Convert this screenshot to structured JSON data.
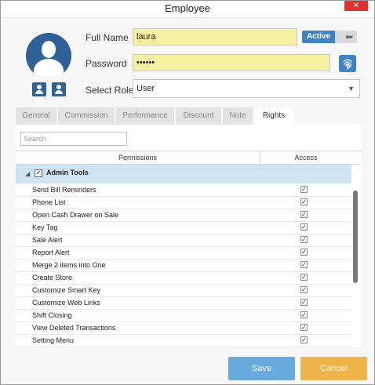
{
  "window": {
    "title": "Employee",
    "close_glyph": "✕"
  },
  "form": {
    "full_name_label": "Full Name",
    "full_name_value": "laura",
    "password_label": "Password",
    "password_value": "••••••",
    "select_role_label": "Select Role",
    "select_role_value": "User",
    "active_label": "Active"
  },
  "icons": {
    "avatar": "user-avatar-icon",
    "user_button_1": "user-icon",
    "user_button_2": "user-lock-icon",
    "fingerprint": "fingerprint-icon",
    "toggle_arrow": "arrow-left-icon",
    "dropdown": "chevron-down-icon"
  },
  "tabs": [
    {
      "label": "General",
      "active": false
    },
    {
      "label": "Commission",
      "active": false
    },
    {
      "label": "Performance",
      "active": false
    },
    {
      "label": "Discount",
      "active": false
    },
    {
      "label": "Note",
      "active": false
    },
    {
      "label": "Rights",
      "active": true
    }
  ],
  "rights": {
    "search_placeholder": "Search",
    "columns": {
      "permissions": "Permissions",
      "access": "Access"
    },
    "group": {
      "label": "Admin Tools",
      "checked": true
    },
    "items": [
      {
        "label": "Send Bill Reminders",
        "access": true
      },
      {
        "label": "Phone List",
        "access": true
      },
      {
        "label": "Open Cash Drawer on Sale",
        "access": true
      },
      {
        "label": "Key Tag",
        "access": true
      },
      {
        "label": "Sale Alert",
        "access": true
      },
      {
        "label": "Report Alert",
        "access": true
      },
      {
        "label": "Merge 2 items into One",
        "access": true
      },
      {
        "label": "Create Store",
        "access": true
      },
      {
        "label": "Customize Smart Key",
        "access": true
      },
      {
        "label": "Customize Web Links",
        "access": true
      },
      {
        "label": "Shift Closing",
        "access": true
      },
      {
        "label": "View Deleted Transactions",
        "access": true
      },
      {
        "label": "Setting Menu",
        "access": true
      }
    ]
  },
  "buttons": {
    "save": "Save",
    "cancel": "Cancel"
  },
  "colors": {
    "accent": "#3f83c4",
    "avatar": "#2d6197",
    "field_highlight": "#f7f2a3",
    "group_row": "#cfe4f3",
    "save": "#67aade",
    "cancel": "#f0b54a",
    "close": "#e2312c"
  }
}
